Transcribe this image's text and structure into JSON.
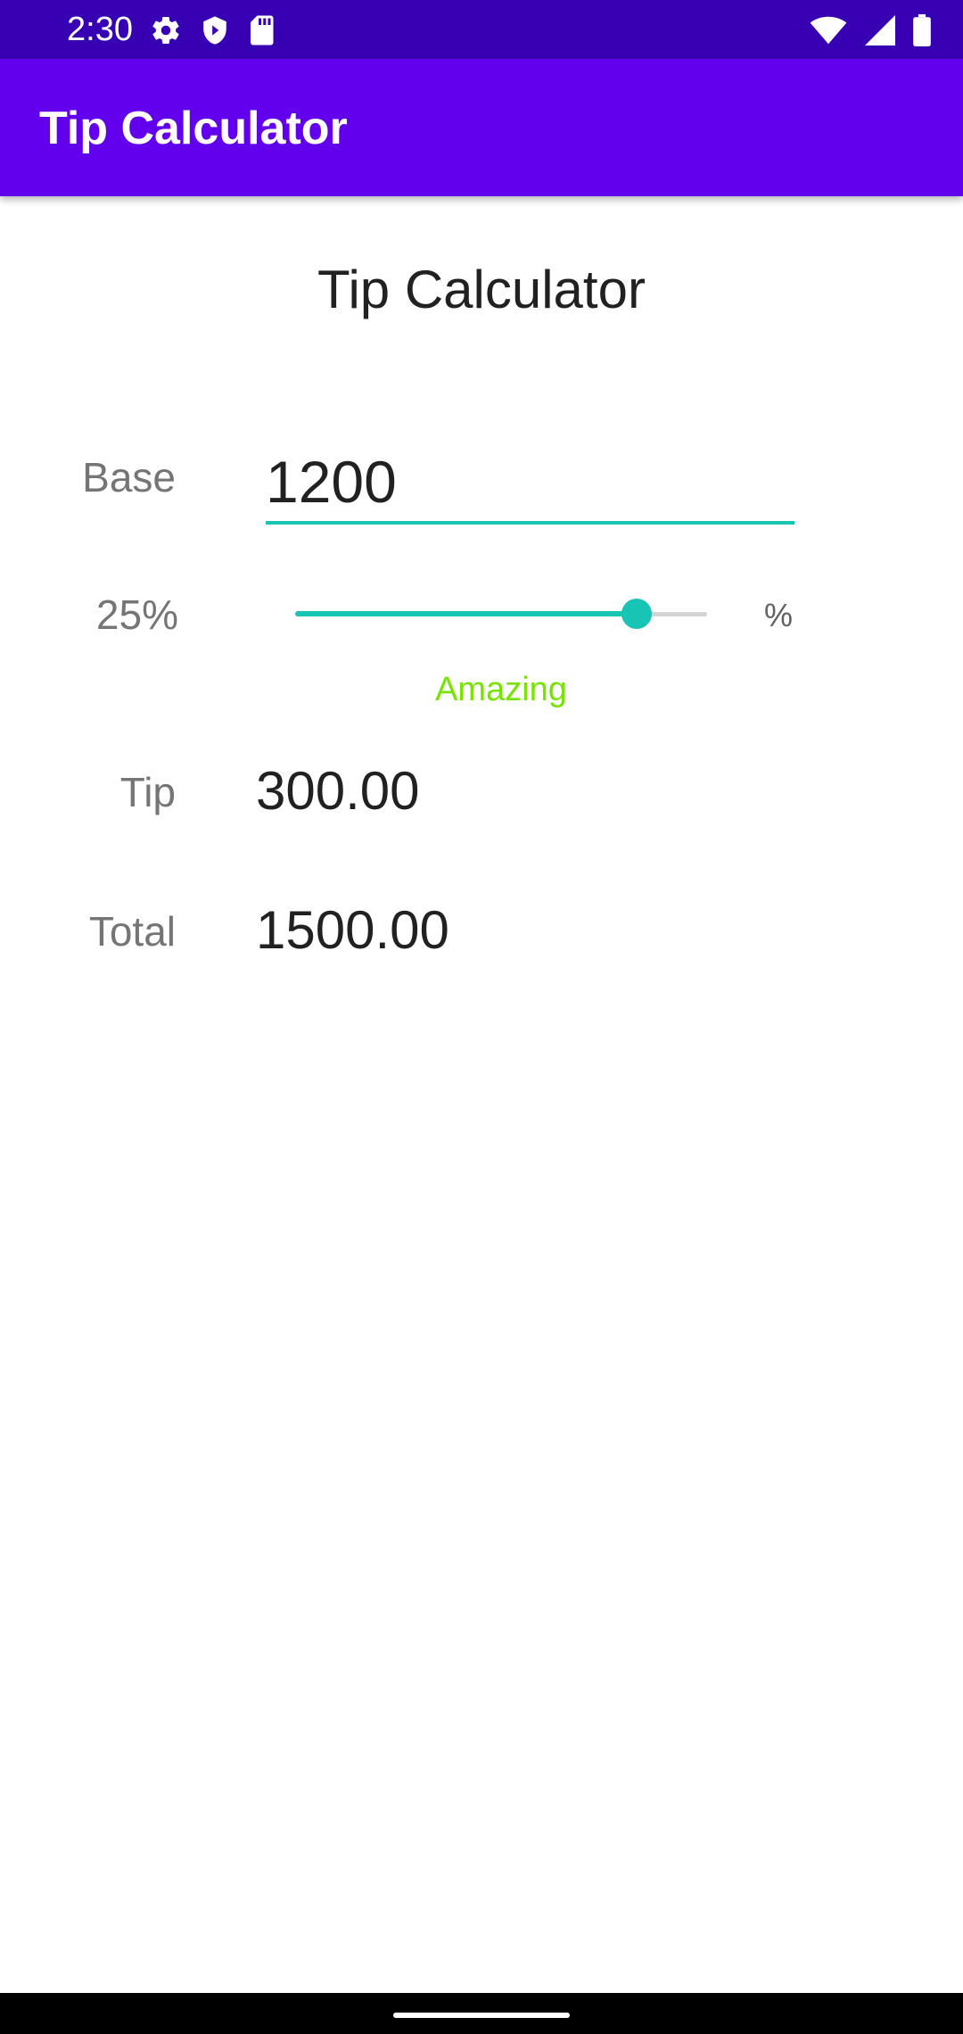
{
  "status_bar": {
    "time": "2:30",
    "icons_left": [
      "settings-icon",
      "shield-icon",
      "sd-card-icon"
    ],
    "icons_right": [
      "wifi-icon",
      "signal-icon",
      "battery-icon"
    ],
    "color": "#3700b3"
  },
  "app_bar": {
    "title": "Tip Calculator",
    "color": "#6200ee"
  },
  "main": {
    "title": "Tip Calculator",
    "base": {
      "label": "Base",
      "value": "1200"
    },
    "tip_percent": {
      "label": "25%",
      "unit": "%",
      "value": 25,
      "slider_fraction": 0.83,
      "description": "Amazing",
      "description_color": "#76e400"
    },
    "tip": {
      "label": "Tip",
      "value": "300.00"
    },
    "total": {
      "label": "Total",
      "value": "1500.00"
    },
    "accent_color": "#18c4b4"
  }
}
